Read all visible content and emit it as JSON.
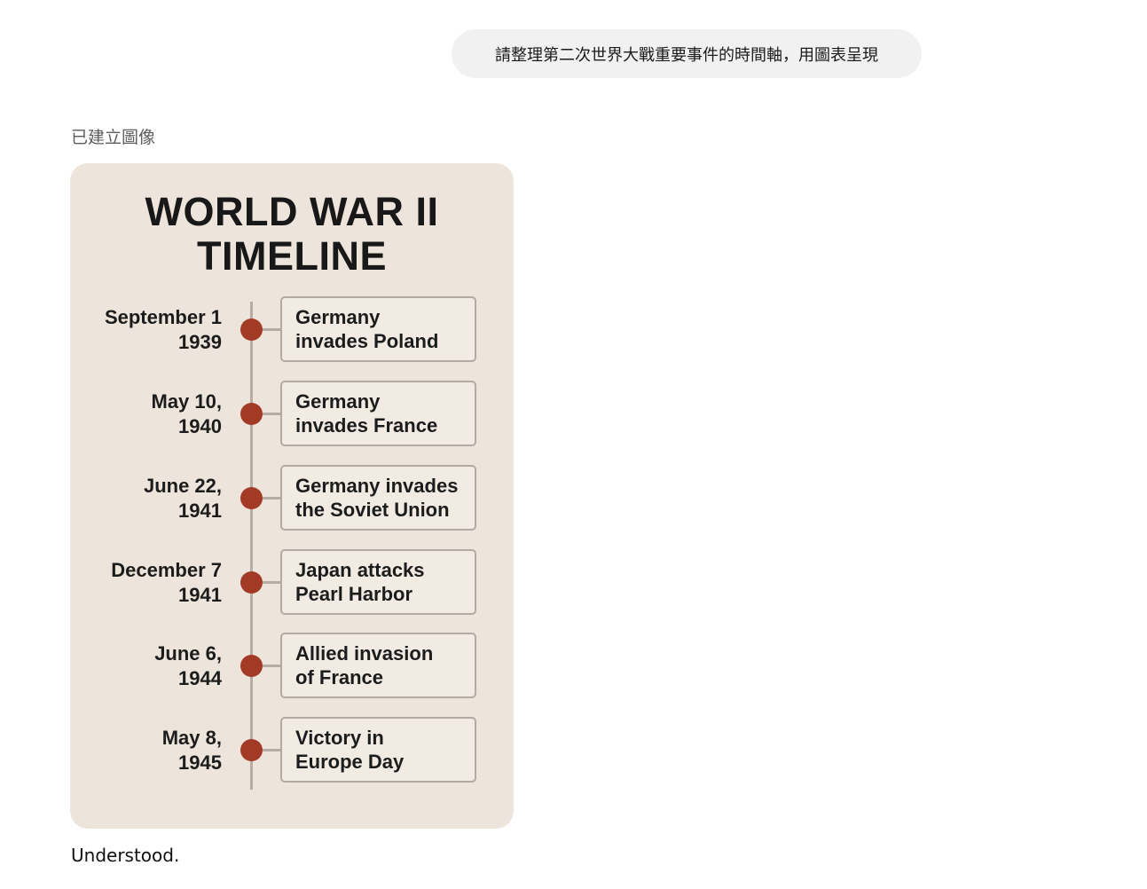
{
  "user_message": "請整理第二次世界大戰重要事件的時間軸，用圖表呈現",
  "image_caption": "已建立圖像",
  "timeline": {
    "title_lines": [
      "WORLD WAR II",
      "TIMELINE"
    ],
    "events": [
      {
        "date_lines": [
          "September 1",
          "1939"
        ],
        "text_lines": [
          "Germany",
          "invades Poland"
        ]
      },
      {
        "date_lines": [
          "May 10,",
          "1940"
        ],
        "text_lines": [
          "Germany",
          "invades France"
        ]
      },
      {
        "date_lines": [
          "June 22,",
          "1941"
        ],
        "text_lines": [
          "Germany invades",
          "the Soviet Union"
        ]
      },
      {
        "date_lines": [
          "December 7",
          "1941"
        ],
        "text_lines": [
          "Japan attacks",
          "Pearl Harbor"
        ]
      },
      {
        "date_lines": [
          "June 6,",
          "1944"
        ],
        "text_lines": [
          "Allied invasion",
          "of France"
        ]
      },
      {
        "date_lines": [
          "May 8,",
          "1945"
        ],
        "text_lines": [
          "Victory in",
          "Europe Day"
        ]
      }
    ]
  },
  "assistant_text": "Understood.",
  "colors": {
    "card_background": "#ede5db",
    "dot": "#a33a26",
    "line": "#b5aca3",
    "bubble": "#f1f1f1"
  }
}
